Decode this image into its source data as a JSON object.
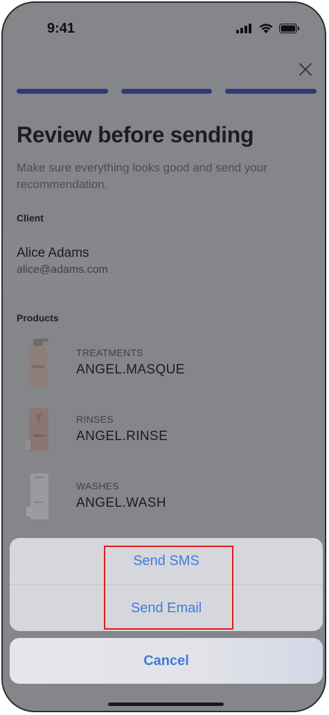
{
  "status_bar": {
    "time": "9:41",
    "icons": [
      "signal-icon",
      "wifi-icon",
      "battery-icon"
    ]
  },
  "header": {
    "close_icon": "close-icon",
    "progress_steps": 3
  },
  "title": "Review before sending",
  "subtitle": "Make sure everything looks good and send your recommendation.",
  "client": {
    "section_label": "Client",
    "name": "Alice Adams",
    "email": "alice@adams.com"
  },
  "products": {
    "section_label": "Products",
    "items": [
      {
        "category": "TREATMENTS",
        "name": "ANGEL.MASQUE"
      },
      {
        "category": "RINSES",
        "name": "ANGEL.RINSE"
      },
      {
        "category": "WASHES",
        "name": "ANGEL.WASH"
      }
    ]
  },
  "action_sheet": {
    "send_sms": "Send SMS",
    "send_email": "Send Email",
    "cancel": "Cancel"
  },
  "colors": {
    "accent": "#3f7bdc",
    "progress": "#2c3a77",
    "highlight": "#e01b1b"
  }
}
